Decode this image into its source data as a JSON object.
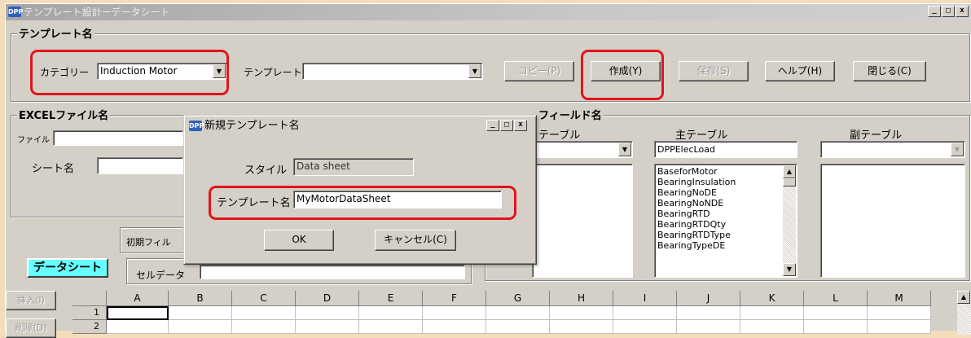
{
  "main_window": {
    "title": "テンプレート設計ーデータシート",
    "app_badge": "DPP"
  },
  "template_group": {
    "label": "テンプレート名",
    "category_label": "カテゴリー",
    "category_value": "Induction Motor",
    "template_label": "テンプレート",
    "template_value": "",
    "buttons": {
      "copy": "コピー(P)",
      "create": "作成(Y)",
      "save": "保存(S)",
      "help": "ヘルプ(H)",
      "close": "閉じる(C)"
    }
  },
  "excel_group": {
    "label": "EXCELファイル名",
    "file_label": "ファイル",
    "sheet_label": "シート名"
  },
  "field_group": {
    "label": "フィールド名",
    "table_label": "テーブル",
    "main_table_label": "主テーブル",
    "main_table_value": "DPPElecLoad",
    "sub_table_label": "副テーブル",
    "main_fields": [
      "BaseforMotor",
      "BearingInsulation",
      "BearingNoDE",
      "BearingNoNDE",
      "BearingRTD",
      "BearingRTDQty",
      "BearingRTDType",
      "BearingTypeDE"
    ]
  },
  "sheet_area": {
    "initial_field_label": "初期フィル",
    "datasheet_label": "データシート",
    "cell_data_label": "セルデータ",
    "insert_button": "挿入(I)",
    "delete_button": "削除(D)",
    "columns": [
      "A",
      "B",
      "C",
      "D",
      "E",
      "F",
      "G",
      "H",
      "I",
      "J",
      "K",
      "L",
      "M"
    ],
    "rows": [
      "1",
      "2"
    ]
  },
  "dialog": {
    "title": "新規テンプレート名",
    "app_badge": "DPP",
    "style_label": "スタイル",
    "style_value": "Data sheet",
    "name_label": "テンプレート名",
    "name_value": "MyMotorDataSheet",
    "ok_button": "OK",
    "cancel_button": "キャンセル(C)"
  },
  "colors": {
    "highlight_red": "#e2141b",
    "datasheet_cyan": "#66ffff",
    "window_face": "#d4d0c8"
  }
}
